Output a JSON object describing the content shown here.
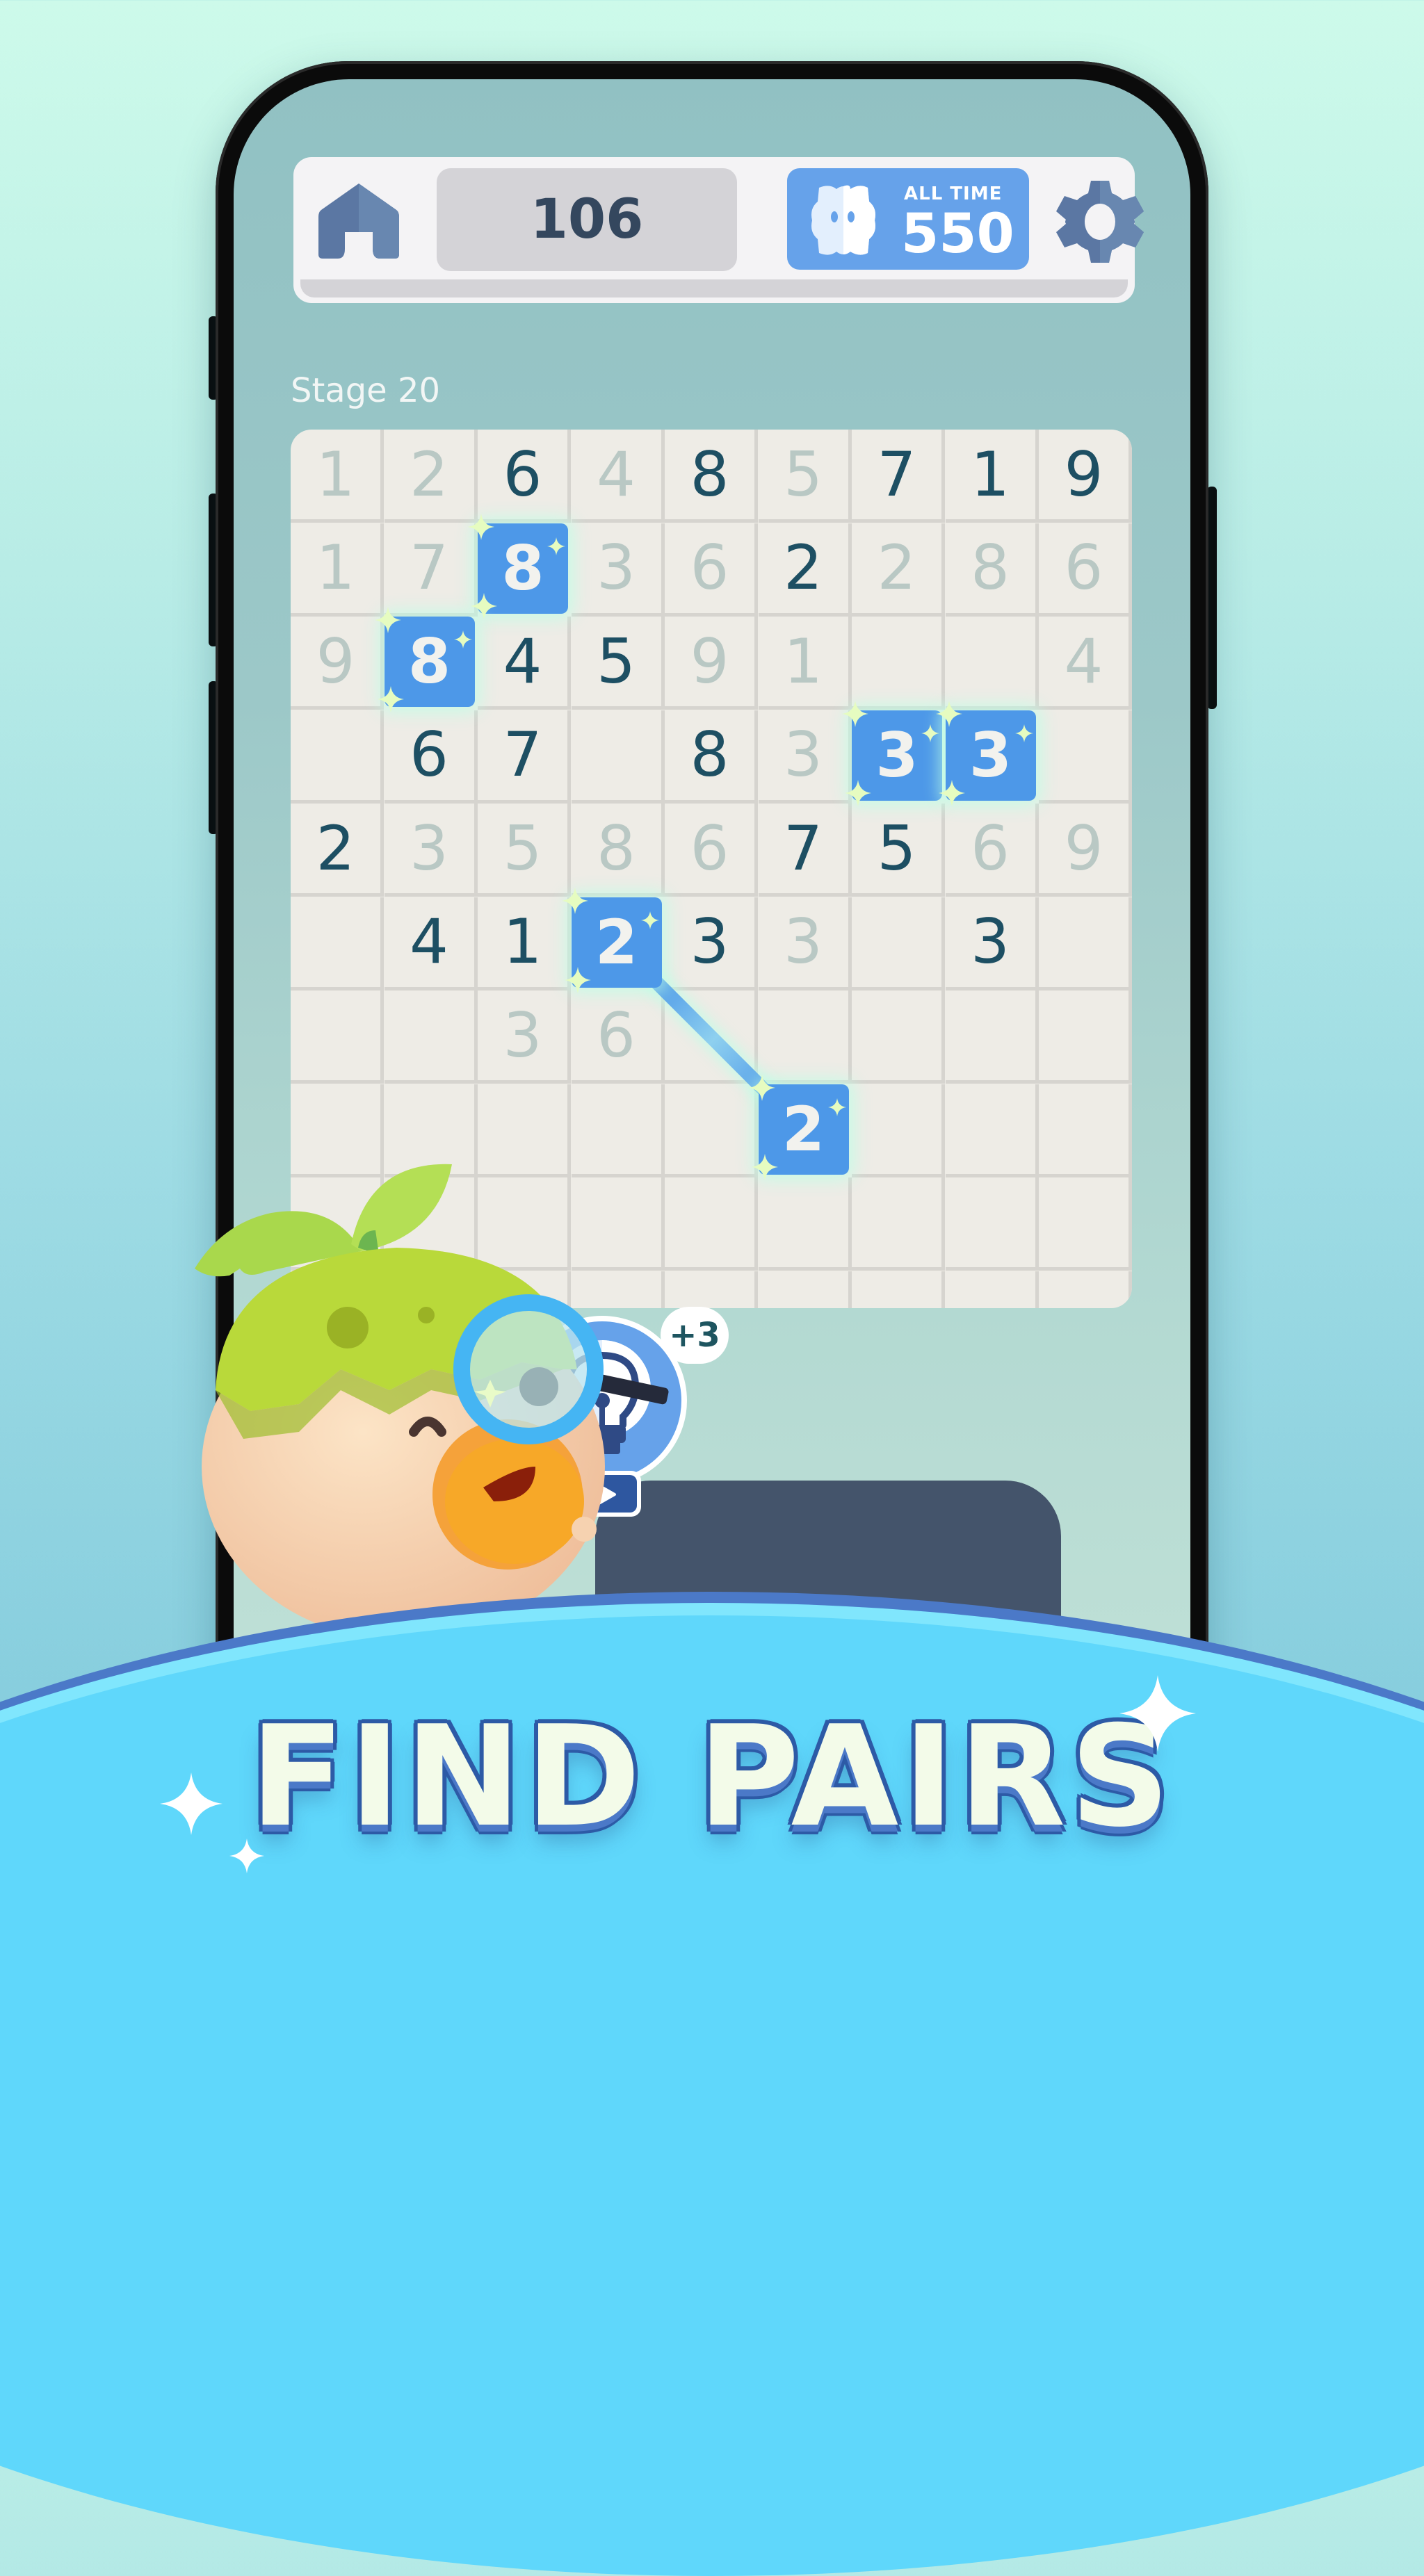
{
  "app": {
    "topbar": {
      "home_icon": "home-icon",
      "current_score": "106",
      "best_label": "ALL TIME",
      "best_score": "550",
      "best_icon": "ghost-badge-icon",
      "settings_icon": "gear-icon",
      "progress": 0
    },
    "stage_label": "Stage 20",
    "board": {
      "columns": 9,
      "rows": [
        [
          {
            "v": "1",
            "s": "faded"
          },
          {
            "v": "2",
            "s": "faded"
          },
          {
            "v": "6",
            "s": "active"
          },
          {
            "v": "4",
            "s": "faded"
          },
          {
            "v": "8",
            "s": "active"
          },
          {
            "v": "5",
            "s": "faded"
          },
          {
            "v": "7",
            "s": "active"
          },
          {
            "v": "1",
            "s": "active"
          },
          {
            "v": "9",
            "s": "active"
          }
        ],
        [
          {
            "v": "1",
            "s": "faded"
          },
          {
            "v": "7",
            "s": "faded"
          },
          {
            "v": "8",
            "s": "highlight"
          },
          {
            "v": "3",
            "s": "faded"
          },
          {
            "v": "6",
            "s": "faded"
          },
          {
            "v": "2",
            "s": "active"
          },
          {
            "v": "2",
            "s": "faded"
          },
          {
            "v": "8",
            "s": "faded"
          },
          {
            "v": "6",
            "s": "faded"
          }
        ],
        [
          {
            "v": "9",
            "s": "faded"
          },
          {
            "v": "8",
            "s": "highlight"
          },
          {
            "v": "4",
            "s": "active"
          },
          {
            "v": "5",
            "s": "active"
          },
          {
            "v": "9",
            "s": "faded"
          },
          {
            "v": "1",
            "s": "faded"
          },
          {
            "v": "",
            "s": "empty"
          },
          {
            "v": "",
            "s": "empty"
          },
          {
            "v": "4",
            "s": "faded"
          }
        ],
        [
          {
            "v": "",
            "s": "empty"
          },
          {
            "v": "6",
            "s": "active"
          },
          {
            "v": "7",
            "s": "active"
          },
          {
            "v": "",
            "s": "empty"
          },
          {
            "v": "8",
            "s": "active"
          },
          {
            "v": "3",
            "s": "faded"
          },
          {
            "v": "3",
            "s": "highlight"
          },
          {
            "v": "3",
            "s": "highlight"
          },
          {
            "v": "",
            "s": "empty"
          }
        ],
        [
          {
            "v": "2",
            "s": "active"
          },
          {
            "v": "3",
            "s": "faded"
          },
          {
            "v": "5",
            "s": "faded"
          },
          {
            "v": "8",
            "s": "faded"
          },
          {
            "v": "6",
            "s": "faded"
          },
          {
            "v": "7",
            "s": "active"
          },
          {
            "v": "5",
            "s": "active"
          },
          {
            "v": "6",
            "s": "faded"
          },
          {
            "v": "9",
            "s": "faded"
          }
        ],
        [
          {
            "v": "",
            "s": "empty"
          },
          {
            "v": "4",
            "s": "active"
          },
          {
            "v": "1",
            "s": "active"
          },
          {
            "v": "2",
            "s": "highlight"
          },
          {
            "v": "3",
            "s": "active"
          },
          {
            "v": "3",
            "s": "faded"
          },
          {
            "v": "",
            "s": "empty"
          },
          {
            "v": "3",
            "s": "active"
          },
          {
            "v": "",
            "s": "empty"
          }
        ],
        [
          {
            "v": "",
            "s": "empty"
          },
          {
            "v": "",
            "s": "empty"
          },
          {
            "v": "3",
            "s": "faded"
          },
          {
            "v": "6",
            "s": "faded"
          },
          {
            "v": "",
            "s": "empty"
          },
          {
            "v": "",
            "s": "empty"
          },
          {
            "v": "",
            "s": "empty"
          },
          {
            "v": "",
            "s": "empty"
          },
          {
            "v": "",
            "s": "empty"
          }
        ],
        [
          {
            "v": "",
            "s": "empty"
          },
          {
            "v": "",
            "s": "empty"
          },
          {
            "v": "",
            "s": "empty"
          },
          {
            "v": "",
            "s": "empty"
          },
          {
            "v": "",
            "s": "empty"
          },
          {
            "v": "2",
            "s": "highlight"
          },
          {
            "v": "",
            "s": "empty"
          },
          {
            "v": "",
            "s": "empty"
          },
          {
            "v": "",
            "s": "empty"
          }
        ],
        [
          {
            "v": "",
            "s": "empty"
          },
          {
            "v": "",
            "s": "empty"
          },
          {
            "v": "",
            "s": "empty"
          },
          {
            "v": "",
            "s": "empty"
          },
          {
            "v": "",
            "s": "empty"
          },
          {
            "v": "",
            "s": "empty"
          },
          {
            "v": "",
            "s": "empty"
          },
          {
            "v": "",
            "s": "empty"
          },
          {
            "v": "",
            "s": "empty"
          }
        ],
        [
          {
            "v": "",
            "s": "empty"
          },
          {
            "v": "",
            "s": "empty"
          },
          {
            "v": "",
            "s": "empty"
          },
          {
            "v": "",
            "s": "empty"
          },
          {
            "v": "",
            "s": "empty"
          },
          {
            "v": "",
            "s": "empty"
          },
          {
            "v": "",
            "s": "empty"
          },
          {
            "v": "",
            "s": "empty"
          },
          {
            "v": "",
            "s": "empty"
          }
        ]
      ],
      "pairs": [
        {
          "a": [
            1,
            2
          ],
          "b": [
            2,
            1
          ]
        },
        {
          "a": [
            3,
            6
          ],
          "b": [
            3,
            7
          ]
        },
        {
          "a": [
            5,
            3
          ],
          "b": [
            7,
            5
          ],
          "connected": true
        }
      ]
    },
    "hint": {
      "icon": "lightbulb-icon",
      "badge": "+3",
      "video_icon": "play-video-icon"
    },
    "mascot": "sprout-mascot-with-magnifier",
    "headline": "FIND PAIRS",
    "colors": {
      "highlight": "#4d98e8",
      "active_digit": "#1d4f63",
      "faded_digit": "#b9c8c4",
      "board_bg": "#eeece6",
      "best_box": "#66a2ea",
      "banner": "#5fd7fb",
      "headline_outline": "#2d5aa6"
    }
  }
}
